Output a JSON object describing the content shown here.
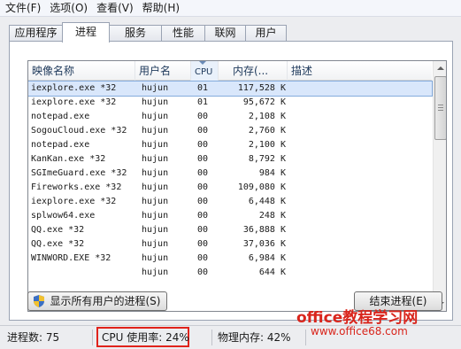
{
  "menu": {
    "file": "文件(F)",
    "options": "选项(O)",
    "view": "查看(V)",
    "help": "帮助(H)"
  },
  "tabs": [
    "应用程序",
    "进程",
    "服务",
    "性能",
    "联网",
    "用户"
  ],
  "active_tab": "进程",
  "columns": {
    "image_name": "映像名称",
    "user_name": "用户名",
    "cpu": "CPU",
    "memory": "内存(...",
    "description": "描述"
  },
  "processes": [
    {
      "name": "iexplore.exe *32",
      "user": "hujun",
      "cpu": "01",
      "mem": "117,528 K",
      "selected": true
    },
    {
      "name": "iexplore.exe *32",
      "user": "hujun",
      "cpu": "01",
      "mem": "95,672 K"
    },
    {
      "name": "notepad.exe",
      "user": "hujun",
      "cpu": "00",
      "mem": "2,108 K"
    },
    {
      "name": "SogouCloud.exe *32",
      "user": "hujun",
      "cpu": "00",
      "mem": "2,760 K"
    },
    {
      "name": "notepad.exe",
      "user": "hujun",
      "cpu": "00",
      "mem": "2,100 K"
    },
    {
      "name": "KanKan.exe *32",
      "user": "hujun",
      "cpu": "00",
      "mem": "8,792 K"
    },
    {
      "name": "SGImeGuard.exe *32",
      "user": "hujun",
      "cpu": "00",
      "mem": "984 K"
    },
    {
      "name": "Fireworks.exe *32",
      "user": "hujun",
      "cpu": "00",
      "mem": "109,080 K"
    },
    {
      "name": "iexplore.exe *32",
      "user": "hujun",
      "cpu": "00",
      "mem": "6,448 K"
    },
    {
      "name": "splwow64.exe",
      "user": "hujun",
      "cpu": "00",
      "mem": "248 K"
    },
    {
      "name": "QQ.exe *32",
      "user": "hujun",
      "cpu": "00",
      "mem": "36,888 K"
    },
    {
      "name": "QQ.exe *32",
      "user": "hujun",
      "cpu": "00",
      "mem": "37,036 K"
    },
    {
      "name": "WINWORD.EXE *32",
      "user": "hujun",
      "cpu": "00",
      "mem": "6,984 K"
    },
    {
      "name": "",
      "user": "hujun",
      "cpu": "00",
      "mem": "644 K"
    }
  ],
  "buttons": {
    "show_all": "显示所有用户的进程(S)",
    "end_process": "结束进程(E)"
  },
  "status": {
    "processes": "进程数: 75",
    "cpu_usage": "CPU 使用率: 24%",
    "physical_memory": "物理内存: 42%"
  },
  "watermark": {
    "line1": "office教程学习网",
    "line2": "www.office68.com"
  },
  "colors": {
    "highlight_box": "#e0231c",
    "watermark": "#d9251c",
    "selection": "#d9e7fb"
  }
}
